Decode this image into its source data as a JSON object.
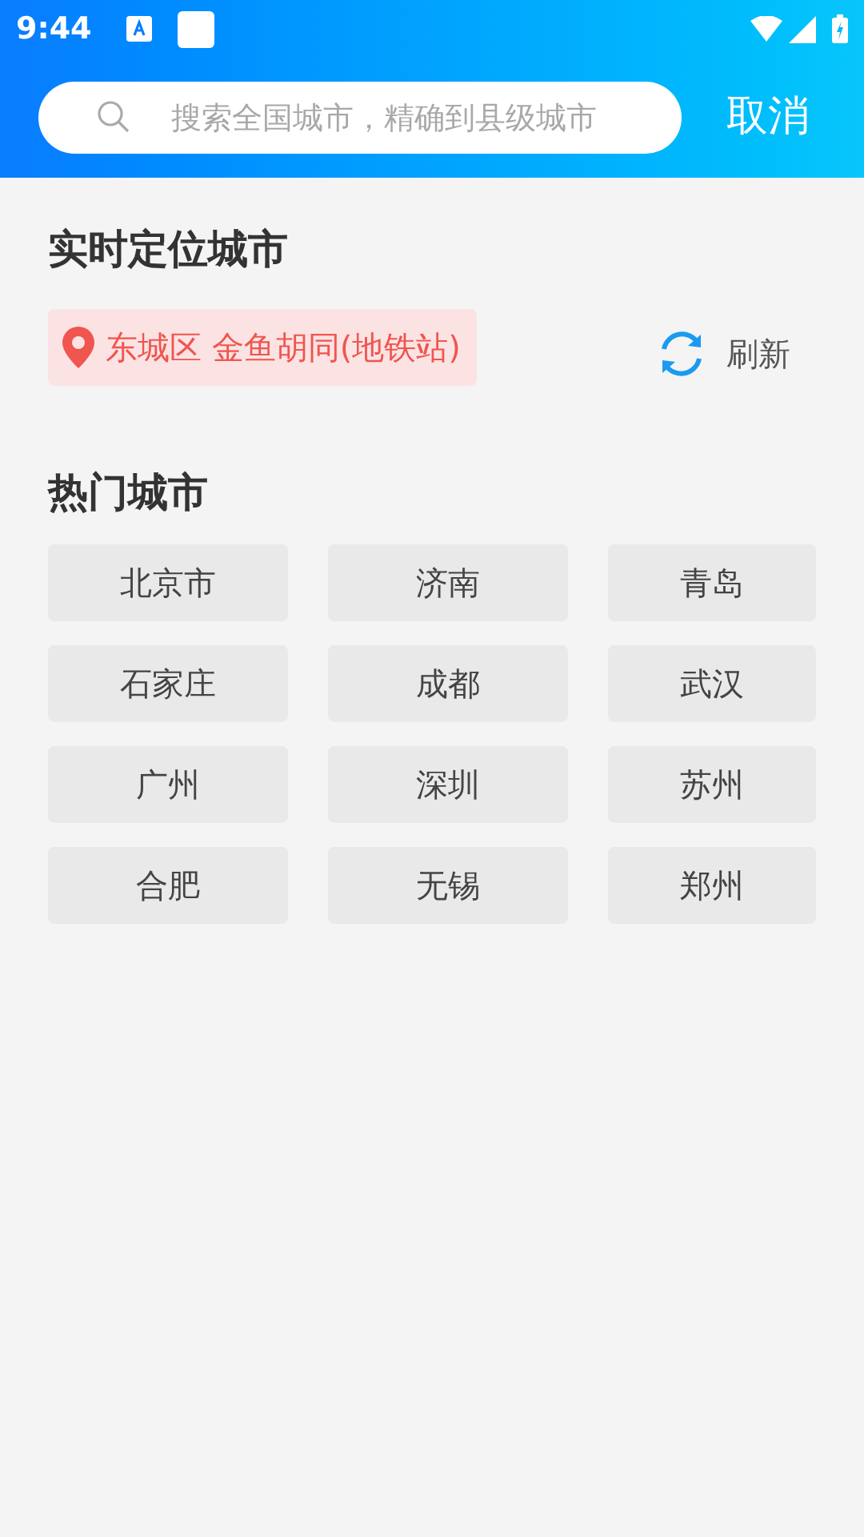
{
  "status_bar": {
    "time": "9:44"
  },
  "search": {
    "placeholder": "搜索全国城市，精确到县级城市",
    "cancel": "取消"
  },
  "location": {
    "title": "实时定位城市",
    "current": "东城区 金鱼胡同(地铁站)",
    "refresh": "刷新"
  },
  "hot_cities": {
    "title": "热门城市",
    "cities": [
      "北京市",
      "济南",
      "青岛",
      "石家庄",
      "成都",
      "武汉",
      "广州",
      "深圳",
      "苏州",
      "合肥",
      "无锡",
      "郑州"
    ]
  }
}
